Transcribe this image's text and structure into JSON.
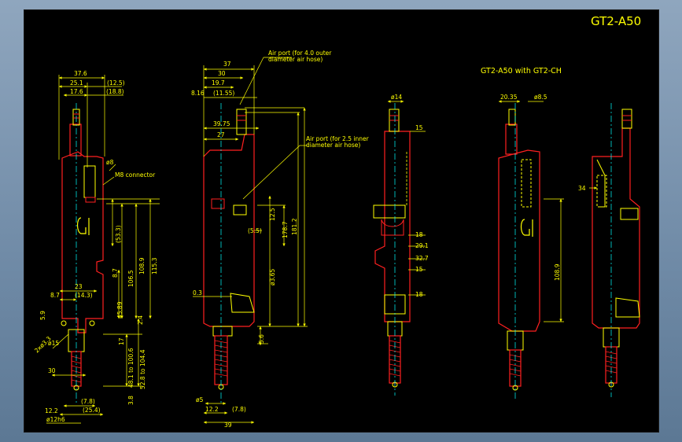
{
  "drawing": {
    "title": "GT2-A50",
    "subtitle": "GT2-A50 with GT2-CH",
    "colors": {
      "background": "#000000",
      "dimension": "#ffff00",
      "outline": "#ff2020",
      "centerline": "#00ffff",
      "frame": "#7b93ad"
    },
    "view1": {
      "dims": [
        "37.6",
        "25.1",
        "(12.5)",
        "17.6",
        "(18.8)",
        "ø8",
        "M8 connector",
        "(53.3)",
        "108.9",
        "115.3",
        "8.7",
        "106.5",
        "23",
        "(14.3)",
        "8.7",
        "45.89",
        "5.9",
        "2xø3.3",
        "ø15",
        "2.4",
        "17",
        "48.1 to 100.6",
        "30",
        "52.8 to 104.4",
        "(7.8)",
        "3.8",
        "12.2",
        "(25.4)",
        "ø12h6"
      ]
    },
    "view2": {
      "dims": [
        "37",
        "30",
        "19.7",
        "8.16",
        "(11.55)",
        "39.75",
        "27",
        "12.5",
        "(5.5)",
        "178.7",
        "181.2",
        "ø3.65",
        "0.3",
        "5.6",
        "ø5",
        "12.2",
        "(7.8)",
        "39"
      ],
      "notes": [
        "Air port (for 4.0 outer",
        "diameter air hose)",
        "Air port (for 2.5 inner",
        "diameter air hose)"
      ]
    },
    "view3": {
      "dims": [
        "ø14",
        "15",
        "18",
        "29.1",
        "32.7",
        "15",
        "18"
      ]
    },
    "view4": {
      "dims": [
        "20.35",
        "ø8.5",
        "108.9",
        "34"
      ]
    }
  }
}
